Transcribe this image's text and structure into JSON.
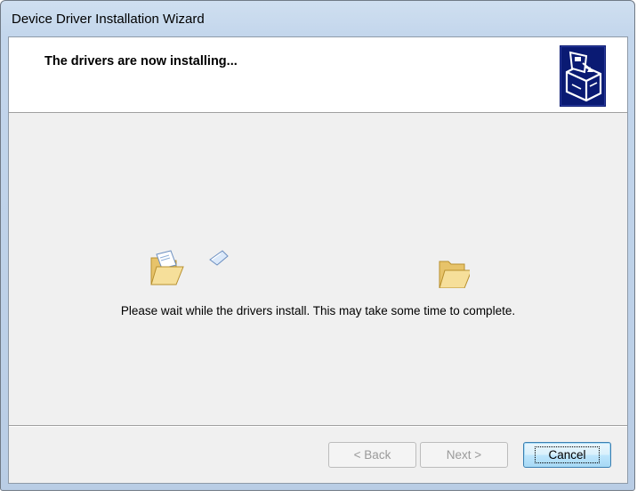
{
  "window": {
    "title": "Device Driver Installation Wizard"
  },
  "header": {
    "title": "The drivers are now installing...",
    "icon": "installer-box-icon"
  },
  "body": {
    "message": "Please wait while the drivers install. This may take some time to complete.",
    "animation_icons": [
      "open-folder-icon",
      "flying-document-icon",
      "open-folder-icon"
    ]
  },
  "buttons": {
    "back": {
      "label": "< Back",
      "enabled": false
    },
    "next": {
      "label": "Next >",
      "enabled": false
    },
    "cancel": {
      "label": "Cancel",
      "enabled": true,
      "default": true
    }
  },
  "colors": {
    "frame": "#c3d6ec",
    "client": "#f0f0f0",
    "header_bg": "#ffffff",
    "icon_bg": "#0a1a73"
  }
}
